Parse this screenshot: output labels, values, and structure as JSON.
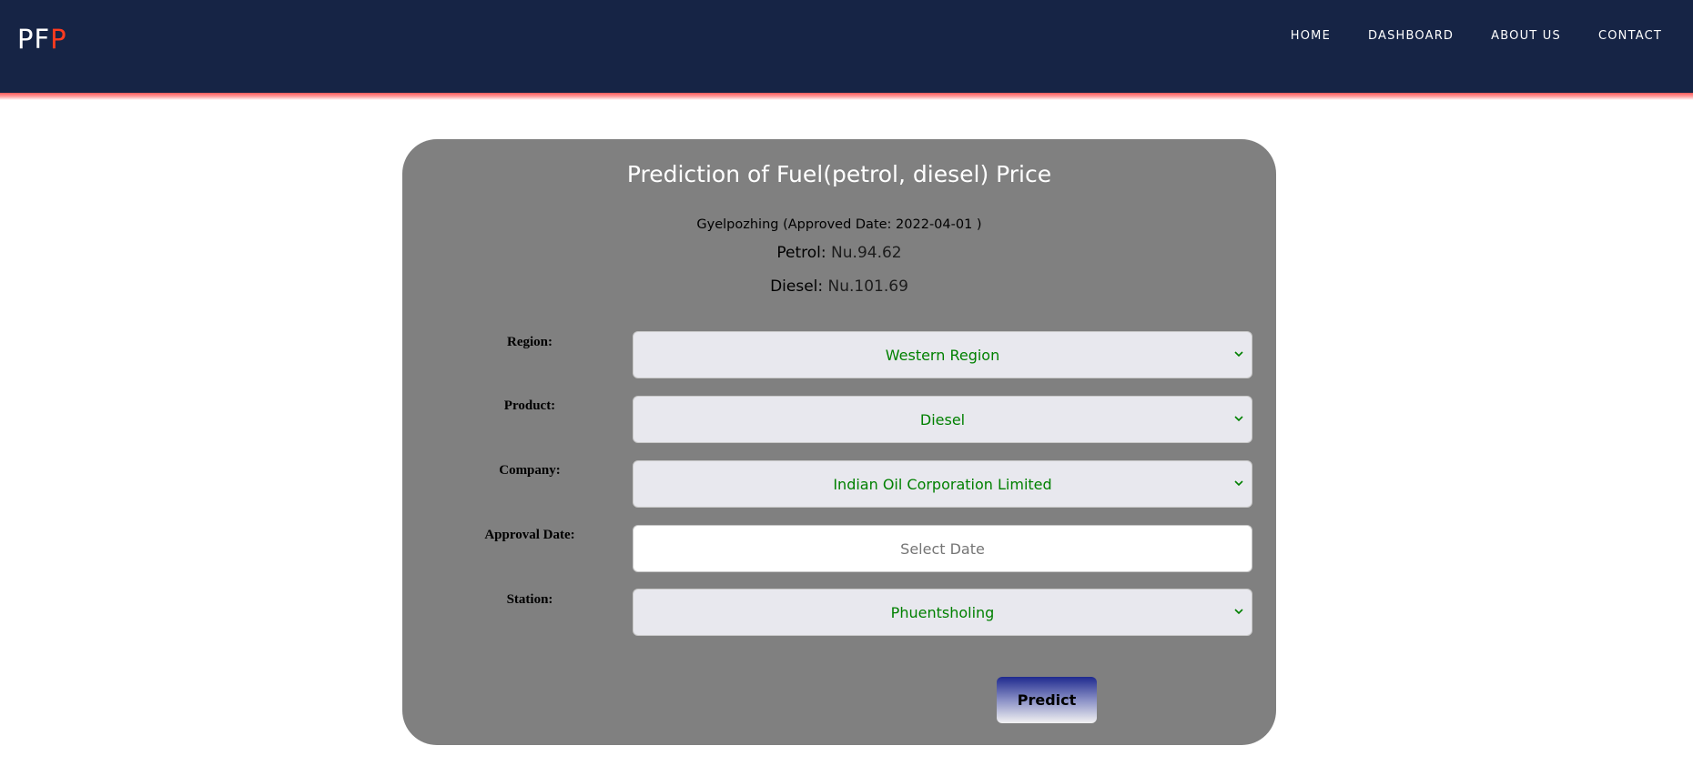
{
  "brand": {
    "logo_main": "PF",
    "logo_accent": "P",
    "accent_color": "#ff3b1f",
    "nav_bg": "#162445"
  },
  "nav": {
    "items": [
      {
        "label": "HOME"
      },
      {
        "label": "DASHBOARD"
      },
      {
        "label": "ABOUT US"
      },
      {
        "label": "CONTACT"
      }
    ]
  },
  "card": {
    "title": "Prediction of Fuel(petrol, diesel) Price",
    "station_info": "Gyelpozhing (Approved Date: 2022-04-01 )",
    "petrol_label": "Petrol:",
    "petrol_value": "Nu.94.62",
    "diesel_label": "Diesel:",
    "diesel_value": "Nu.101.69"
  },
  "form": {
    "region": {
      "label": "Region:",
      "value": "Western Region"
    },
    "product": {
      "label": "Product:",
      "value": "Diesel"
    },
    "company": {
      "label": "Company:",
      "value": "Indian Oil Corporation Limited"
    },
    "approval_date": {
      "label": "Approval Date:",
      "placeholder": "Select Date"
    },
    "station": {
      "label": "Station:",
      "value": "Phuentsholing"
    },
    "submit_label": "Predict"
  },
  "colors": {
    "card_bg": "#808080",
    "select_text": "#008000"
  },
  "icons": {
    "select_arrow": "chevron-down-icon"
  }
}
